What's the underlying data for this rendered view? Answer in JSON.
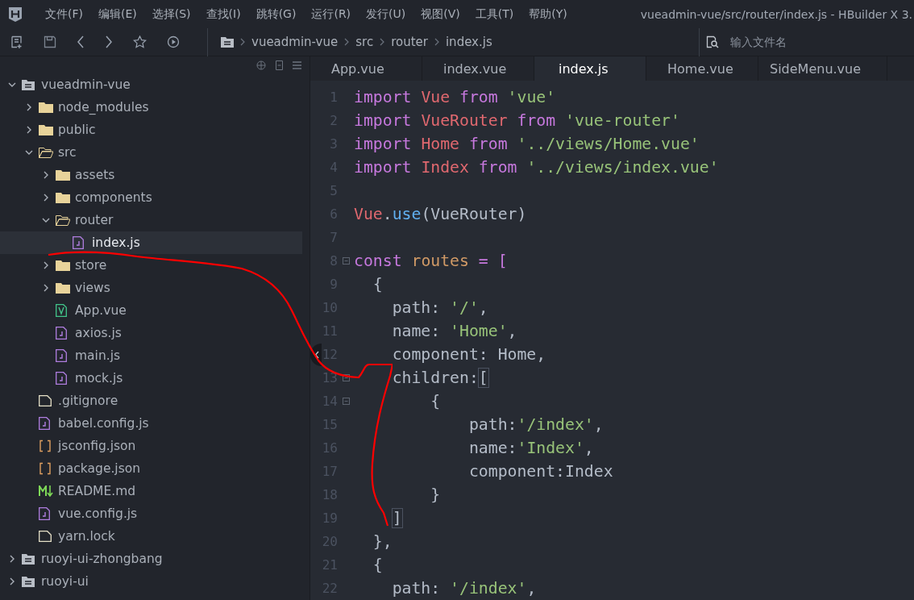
{
  "window": {
    "title": "vueadmin-vue/src/router/index.js - HBuilder X 3."
  },
  "menu": [
    "文件(F)",
    "编辑(E)",
    "选择(S)",
    "查找(I)",
    "跳转(G)",
    "运行(R)",
    "发行(U)",
    "视图(V)",
    "工具(T)",
    "帮助(Y)"
  ],
  "breadcrumb": [
    "vueadmin-vue",
    "src",
    "router",
    "index.js"
  ],
  "file_search": {
    "placeholder": "输入文件名"
  },
  "tree": [
    {
      "label": "vueadmin-vue",
      "kind": "project",
      "expanded": true,
      "selected": false,
      "children": [
        {
          "label": "node_modules",
          "kind": "folder",
          "expanded": false,
          "selected": false
        },
        {
          "label": "public",
          "kind": "folder",
          "expanded": false,
          "selected": false
        },
        {
          "label": "src",
          "kind": "folder",
          "expanded": true,
          "selected": false,
          "children": [
            {
              "label": "assets",
              "kind": "folder",
              "expanded": false,
              "selected": false
            },
            {
              "label": "components",
              "kind": "folder",
              "expanded": false,
              "selected": false
            },
            {
              "label": "router",
              "kind": "folder",
              "expanded": true,
              "selected": false,
              "children": [
                {
                  "label": "index.js",
                  "kind": "js",
                  "selected": true
                }
              ]
            },
            {
              "label": "store",
              "kind": "folder",
              "expanded": false,
              "selected": false
            },
            {
              "label": "views",
              "kind": "folder",
              "expanded": false,
              "selected": false
            },
            {
              "label": "App.vue",
              "kind": "vue",
              "selected": false
            },
            {
              "label": "axios.js",
              "kind": "js",
              "selected": false
            },
            {
              "label": "main.js",
              "kind": "js",
              "selected": false
            },
            {
              "label": "mock.js",
              "kind": "js",
              "selected": false
            }
          ]
        },
        {
          "label": ".gitignore",
          "kind": "file",
          "selected": false
        },
        {
          "label": "babel.config.js",
          "kind": "js",
          "selected": false
        },
        {
          "label": "jsconfig.json",
          "kind": "json",
          "selected": false
        },
        {
          "label": "package.json",
          "kind": "json",
          "selected": false
        },
        {
          "label": "README.md",
          "kind": "md",
          "selected": false
        },
        {
          "label": "vue.config.js",
          "kind": "js",
          "selected": false
        },
        {
          "label": "yarn.lock",
          "kind": "file",
          "selected": false
        }
      ]
    },
    {
      "label": "ruoyi-ui-zhongbang",
      "kind": "project",
      "expanded": false,
      "selected": false
    },
    {
      "label": "ruoyi-ui",
      "kind": "project",
      "expanded": false,
      "selected": false
    }
  ],
  "tabs": [
    {
      "label": "App.vue",
      "selected": false
    },
    {
      "label": "index.vue",
      "selected": false
    },
    {
      "label": "index.js",
      "selected": true
    },
    {
      "label": "Home.vue",
      "selected": false
    },
    {
      "label": "SideMenu.vue",
      "selected": false
    }
  ],
  "code": [
    {
      "n": "1",
      "fold": false,
      "tokens": [
        {
          "t": "import ",
          "kind": "keyword"
        },
        {
          "t": "Vue ",
          "kind": "ident"
        },
        {
          "t": "from ",
          "kind": "keyword"
        },
        {
          "t": "'vue'",
          "kind": "string"
        }
      ]
    },
    {
      "n": "2",
      "fold": false,
      "tokens": [
        {
          "t": "import ",
          "kind": "keyword"
        },
        {
          "t": "VueRouter ",
          "kind": "ident"
        },
        {
          "t": "from ",
          "kind": "keyword"
        },
        {
          "t": "'vue-router'",
          "kind": "string"
        }
      ]
    },
    {
      "n": "3",
      "fold": false,
      "tokens": [
        {
          "t": "import ",
          "kind": "keyword"
        },
        {
          "t": "Home ",
          "kind": "ident"
        },
        {
          "t": "from ",
          "kind": "keyword"
        },
        {
          "t": "'../views/Home.vue'",
          "kind": "string"
        }
      ]
    },
    {
      "n": "4",
      "fold": false,
      "tokens": [
        {
          "t": "import ",
          "kind": "keyword"
        },
        {
          "t": "Index ",
          "kind": "ident"
        },
        {
          "t": "from ",
          "kind": "keyword"
        },
        {
          "t": "'../views/index.vue'",
          "kind": "string"
        }
      ]
    },
    {
      "n": "5",
      "fold": false
    },
    {
      "n": "6",
      "fold": false,
      "tokens": [
        {
          "t": "Vue",
          "kind": "ident"
        },
        {
          "t": ".",
          "kind": "plain"
        },
        {
          "t": "use",
          "kind": "func"
        },
        {
          "t": "(VueRouter)",
          "kind": "plain"
        }
      ]
    },
    {
      "n": "7",
      "fold": false
    },
    {
      "n": "8",
      "fold": true,
      "tokens": [
        {
          "t": "const ",
          "kind": "keyword"
        },
        {
          "t": "routes ",
          "kind": "variable"
        },
        {
          "t": "= [",
          "kind": "keyword"
        }
      ]
    },
    {
      "n": "9",
      "fold": false,
      "tokens": [
        {
          "t": "  {",
          "kind": "plain"
        }
      ]
    },
    {
      "n": "10",
      "fold": false,
      "tokens": [
        {
          "t": "    path: ",
          "kind": "plain"
        },
        {
          "t": "'/'",
          "kind": "string"
        },
        {
          "t": ",",
          "kind": "plain"
        }
      ]
    },
    {
      "n": "11",
      "fold": false,
      "tokens": [
        {
          "t": "    name: ",
          "kind": "plain"
        },
        {
          "t": "'Home'",
          "kind": "string"
        },
        {
          "t": ",",
          "kind": "plain"
        }
      ]
    },
    {
      "n": "12",
      "fold": false,
      "tokens": [
        {
          "t": "    component: Home,",
          "kind": "plain"
        }
      ]
    },
    {
      "n": "13",
      "fold": true,
      "tokens": [
        {
          "t": "    children:",
          "kind": "plain"
        },
        {
          "t": "[",
          "kind": "match"
        }
      ]
    },
    {
      "n": "14",
      "fold": true,
      "tokens": [
        {
          "t": "        {",
          "kind": "plain"
        }
      ]
    },
    {
      "n": "15",
      "fold": false,
      "tokens": [
        {
          "t": "            path:",
          "kind": "plain"
        },
        {
          "t": "'/index'",
          "kind": "string"
        },
        {
          "t": ",",
          "kind": "plain"
        }
      ]
    },
    {
      "n": "16",
      "fold": false,
      "tokens": [
        {
          "t": "            name:",
          "kind": "plain"
        },
        {
          "t": "'Index'",
          "kind": "string"
        },
        {
          "t": ",",
          "kind": "plain"
        }
      ]
    },
    {
      "n": "17",
      "fold": false,
      "tokens": [
        {
          "t": "            component:Index",
          "kind": "plain"
        }
      ]
    },
    {
      "n": "18",
      "fold": false,
      "tokens": [
        {
          "t": "        }",
          "kind": "plain"
        }
      ]
    },
    {
      "n": "19",
      "fold": false,
      "tokens": [
        {
          "t": "    ]",
          "kind": "match"
        }
      ]
    },
    {
      "n": "20",
      "fold": false,
      "tokens": [
        {
          "t": "  },",
          "kind": "plain"
        }
      ]
    },
    {
      "n": "21",
      "fold": false,
      "tokens": [
        {
          "t": "  {",
          "kind": "plain"
        }
      ]
    },
    {
      "n": "22",
      "fold": false,
      "tokens": [
        {
          "t": "    path: ",
          "kind": "plain"
        },
        {
          "t": "'/index'",
          "kind": "string"
        },
        {
          "t": ",",
          "kind": "plain"
        }
      ]
    }
  ]
}
